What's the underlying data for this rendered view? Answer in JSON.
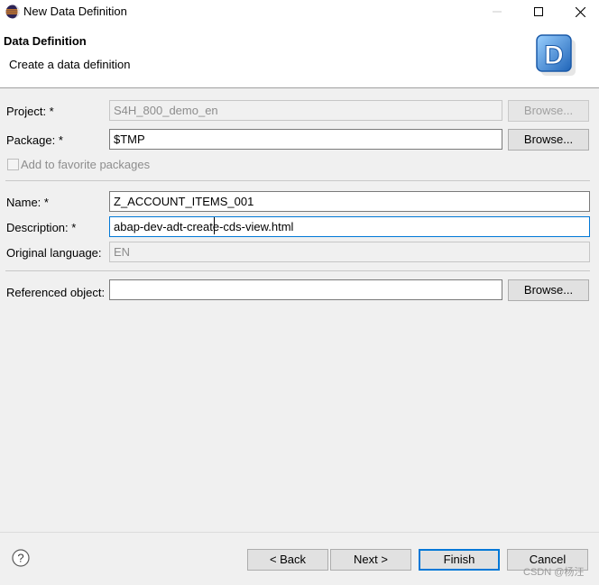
{
  "window": {
    "title": "New Data Definition"
  },
  "header": {
    "title": "Data Definition",
    "subtitle": "Create a data definition",
    "logo_letter": "D"
  },
  "form": {
    "project": {
      "label": "Project: *",
      "value": "S4H_800_demo_en",
      "browse": "Browse..."
    },
    "package": {
      "label": "Package: *",
      "value": "$TMP",
      "browse": "Browse..."
    },
    "favorite": {
      "label": "Add to favorite packages"
    },
    "name": {
      "label": "Name: *",
      "value": "Z_ACCOUNT_ITEMS_001"
    },
    "description": {
      "label": "Description: *",
      "value": "abap-dev-adt-create-cds-view.html"
    },
    "original_language": {
      "label": "Original language:",
      "value": "EN"
    },
    "referenced_object": {
      "label": "Referenced object:",
      "value": "",
      "browse": "Browse..."
    }
  },
  "footer": {
    "back": "< Back",
    "next": "Next >",
    "finish": "Finish",
    "cancel": "Cancel"
  },
  "watermark": "CSDN @杨汪",
  "colors": {
    "accent": "#0078d7",
    "logo_blue": "#2f7fd0"
  }
}
